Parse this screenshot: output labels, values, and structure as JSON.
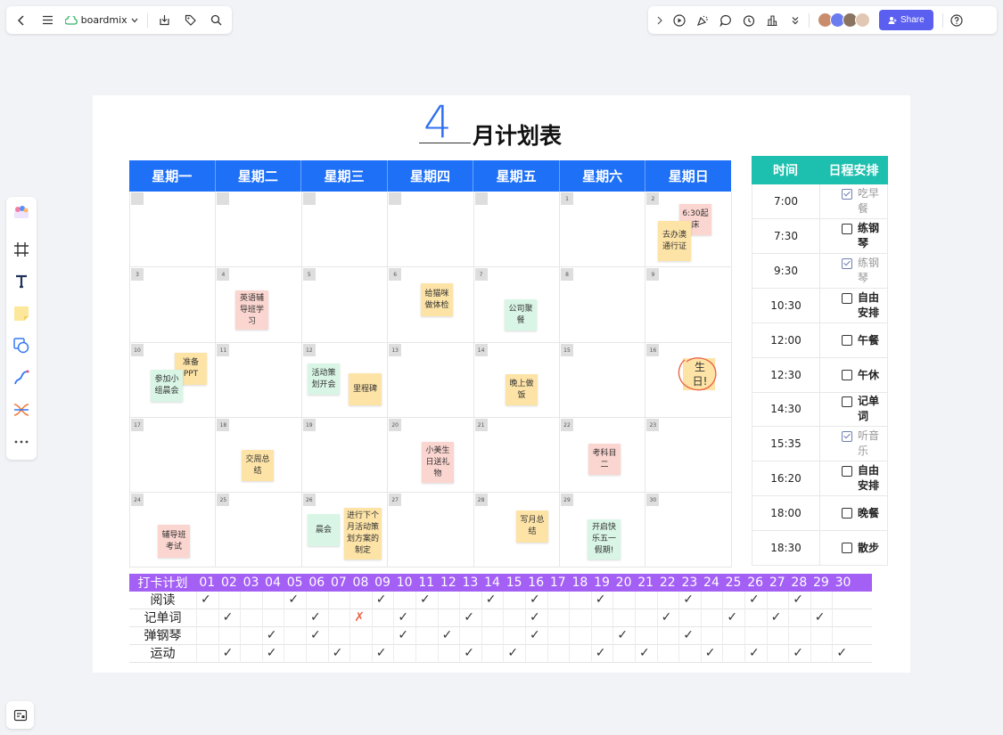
{
  "topbar": {
    "app_name": "boardmix",
    "share_label": "Share"
  },
  "calendar": {
    "title_number": "4",
    "title_text": "月计划表",
    "weekdays": [
      "星期一",
      "星期二",
      "星期三",
      "星期四",
      "星期五",
      "星期六",
      "星期日"
    ],
    "days": [
      "",
      "",
      "",
      "",
      "",
      "1",
      "2",
      "3",
      "4",
      "5",
      "6",
      "7",
      "8",
      "9",
      "10",
      "11",
      "12",
      "13",
      "14",
      "15",
      "16",
      "17",
      "18",
      "19",
      "20",
      "21",
      "22",
      "23",
      "24",
      "25",
      "26",
      "27",
      "28",
      "29",
      "30"
    ],
    "notes": [
      {
        "text": "6:30起床",
        "color": "pink"
      },
      {
        "text": "去办澳通行证",
        "color": "yellow"
      },
      {
        "text": "英语辅导班学习",
        "color": "pink"
      },
      {
        "text": "给猫咪做体检",
        "color": "yellow"
      },
      {
        "text": "公司聚餐",
        "color": "green"
      },
      {
        "text": "准备PPT",
        "color": "yellow"
      },
      {
        "text": "参加小组晨会",
        "color": "green"
      },
      {
        "text": "活动策划开会",
        "color": "green"
      },
      {
        "text": "里程碑",
        "color": "yellow"
      },
      {
        "text": "晚上做饭",
        "color": "yellow"
      },
      {
        "text": "生日!",
        "color": "circle"
      },
      {
        "text": "交周总结",
        "color": "yellow"
      },
      {
        "text": "小美生日送礼物",
        "color": "pink"
      },
      {
        "text": "考科目二",
        "color": "pink"
      },
      {
        "text": "辅导班考试",
        "color": "pink"
      },
      {
        "text": "晨会",
        "color": "green"
      },
      {
        "text": "进行下个月活动策划方案的制定",
        "color": "yellow"
      },
      {
        "text": "写月总结",
        "color": "yellow"
      },
      {
        "text": "开启快乐五一假期!",
        "color": "green"
      }
    ]
  },
  "schedule": {
    "header_time": "时间",
    "header_task": "日程安排",
    "rows": [
      {
        "time": "7:00",
        "task": "吃早餐",
        "done": true
      },
      {
        "time": "7:30",
        "task": "练钢琴",
        "done": false
      },
      {
        "time": "9:30",
        "task": "练钢琴",
        "done": true
      },
      {
        "time": "10:30",
        "task": "自由安排",
        "done": false
      },
      {
        "time": "12:00",
        "task": "午餐",
        "done": false
      },
      {
        "time": "12:30",
        "task": "午休",
        "done": false
      },
      {
        "time": "14:30",
        "task": "记单词",
        "done": false
      },
      {
        "time": "15:35",
        "task": "听音乐",
        "done": true
      },
      {
        "time": "16:20",
        "task": "自由安排",
        "done": false
      },
      {
        "time": "18:00",
        "task": "晚餐",
        "done": false
      },
      {
        "time": "18:30",
        "task": "散步",
        "done": false
      }
    ]
  },
  "checkin": {
    "title": "打卡计划",
    "days": [
      "01",
      "02",
      "03",
      "04",
      "05",
      "06",
      "07",
      "08",
      "09",
      "10",
      "11",
      "12",
      "13",
      "14",
      "15",
      "16",
      "17",
      "18",
      "19",
      "20",
      "21",
      "22",
      "23",
      "24",
      "25",
      "26",
      "27",
      "28",
      "29",
      "30"
    ],
    "rows": [
      {
        "label": "阅读",
        "ticks": [
          1,
          5,
          9,
          11,
          14,
          16,
          19,
          23,
          26,
          28
        ]
      },
      {
        "label": "记单词",
        "ticks": [
          2,
          6,
          10,
          13,
          16,
          22,
          25,
          27,
          29
        ]
      },
      {
        "label": "弹钢琴",
        "ticks": [
          4,
          6,
          10,
          12,
          16,
          20,
          23
        ]
      },
      {
        "label": "运动",
        "ticks": [
          2,
          4,
          7,
          9,
          13,
          15,
          19,
          21,
          24,
          26,
          28,
          30
        ]
      }
    ],
    "cross_day": 8,
    "cross_row": "记单词"
  }
}
